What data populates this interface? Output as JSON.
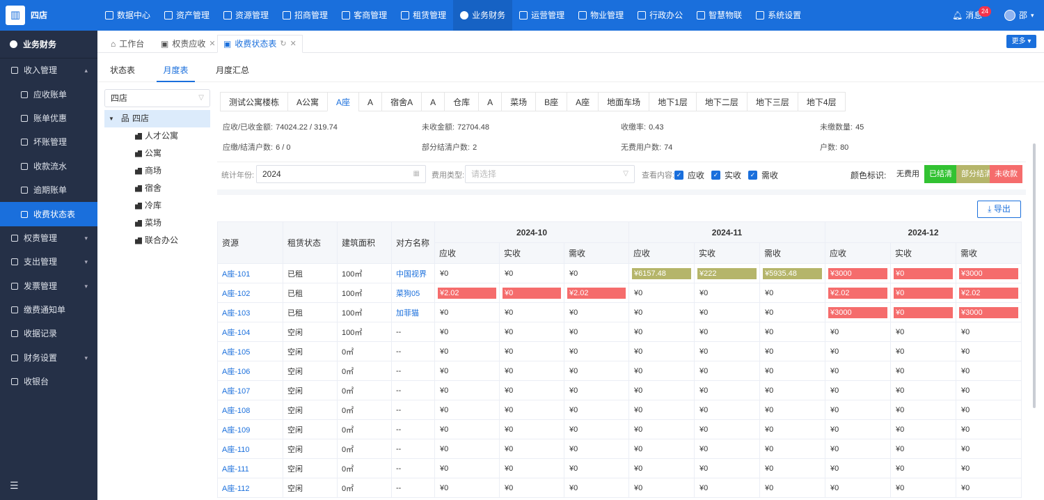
{
  "shop_name": "四店",
  "topnav": [
    "数据中心",
    "资产管理",
    "资源管理",
    "招商管理",
    "客商管理",
    "租赁管理",
    "业务财务",
    "运营管理",
    "物业管理",
    "行政办公",
    "智慧物联",
    "系统设置"
  ],
  "topnav_active": "业务财务",
  "message": {
    "label": "消息",
    "count": "24"
  },
  "user": {
    "name": "邵"
  },
  "sidebar": {
    "title": "业务财务",
    "items": [
      {
        "label": "收入管理",
        "level": 0,
        "chev": "▴"
      },
      {
        "label": "应收账单",
        "level": 1
      },
      {
        "label": "账单优惠",
        "level": 1
      },
      {
        "label": "坏账管理",
        "level": 1
      },
      {
        "label": "收款流水",
        "level": 1
      },
      {
        "label": "逾期账单",
        "level": 1
      },
      {
        "label": "收费状态表",
        "level": 1,
        "active": true
      },
      {
        "label": "权责管理",
        "level": 0,
        "chev": "▾"
      },
      {
        "label": "支出管理",
        "level": 0,
        "chev": "▾"
      },
      {
        "label": "发票管理",
        "level": 0,
        "chev": "▾"
      },
      {
        "label": "缴费通知单",
        "level": 0
      },
      {
        "label": "收据记录",
        "level": 0
      },
      {
        "label": "财务设置",
        "level": 0,
        "chev": "▾"
      },
      {
        "label": "收银台",
        "level": 0
      }
    ]
  },
  "page_tabs": [
    {
      "label": "工作台"
    },
    {
      "label": "权责应收"
    },
    {
      "label": "收费状态表",
      "active": true
    }
  ],
  "more_label": "更多 ▾",
  "subtabs": [
    "状态表",
    "月度表",
    "月度汇总"
  ],
  "tree": {
    "select": "四店",
    "root": "四店",
    "children": [
      "人才公寓",
      "公寓",
      "商场",
      "宿舍",
      "冷库",
      "菜场",
      "联合办公"
    ]
  },
  "building_tabs": [
    "测试公寓楼栋",
    "A公寓",
    "A座",
    "A",
    "宿舍A",
    "A",
    "仓库",
    "A",
    "菜场",
    "B座",
    "A座",
    "地面车场",
    "地下1层",
    "地下二层",
    "地下三层",
    "地下4层"
  ],
  "building_active": 2,
  "stats": [
    {
      "label": "应收/已收金额:",
      "value": "74024.22 / 319.74"
    },
    {
      "label": "未收金额:",
      "value": "72704.48"
    },
    {
      "label": "收缴率:",
      "value": "0.43"
    },
    {
      "label": "未缴数量:",
      "value": "45"
    },
    {
      "label": "应缴/结清户数:",
      "value": "6 / 0"
    },
    {
      "label": "部分结清户数:",
      "value": "2"
    },
    {
      "label": "无费用户数:",
      "value": "74"
    },
    {
      "label": "户数:",
      "value": "80"
    }
  ],
  "filter": {
    "year_label": "统计年份:",
    "year_value": "2024",
    "type_label": "费用类型:",
    "type_placeholder": "请选择",
    "view_label": "查看内容:",
    "checks": [
      "应收",
      "实收",
      "需收"
    ],
    "color_label": "颜色标识:",
    "legend": [
      {
        "label": "无费用",
        "color": "#ffffff"
      },
      {
        "label": "已结清",
        "color": "#32c232"
      },
      {
        "label": "部分结清",
        "color": "#b5b56a"
      },
      {
        "label": "未收款",
        "color": "#f56c6c"
      }
    ]
  },
  "export_label": "导出",
  "table": {
    "fixed_headers": [
      "资源",
      "租赁状态",
      "建筑面积",
      "对方名称"
    ],
    "months": [
      "2024-10",
      "2024-11",
      "2024-12"
    ],
    "sub_headers": [
      "应收",
      "实收",
      "需收"
    ],
    "rows": [
      {
        "res": "A座-101",
        "status": "已租",
        "area": "100㎡",
        "party": "中国视界",
        "cells": [
          [
            "¥0",
            ""
          ],
          [
            "¥0",
            ""
          ],
          [
            "¥0",
            ""
          ],
          [
            "¥6157.48",
            "p"
          ],
          [
            "¥222",
            "p"
          ],
          [
            "¥5935.48",
            "p"
          ],
          [
            "¥3000",
            "u"
          ],
          [
            "¥0",
            "u"
          ],
          [
            "¥3000",
            "u"
          ]
        ]
      },
      {
        "res": "A座-102",
        "status": "已租",
        "area": "100㎡",
        "party": "菜狗05",
        "cells": [
          [
            "¥2.02",
            "u"
          ],
          [
            "¥0",
            "u"
          ],
          [
            "¥2.02",
            "u"
          ],
          [
            "¥0",
            ""
          ],
          [
            "¥0",
            ""
          ],
          [
            "¥0",
            ""
          ],
          [
            "¥2.02",
            "u"
          ],
          [
            "¥0",
            "u"
          ],
          [
            "¥2.02",
            "u"
          ]
        ]
      },
      {
        "res": "A座-103",
        "status": "已租",
        "area": "100㎡",
        "party": "加菲猫",
        "cells": [
          [
            "¥0",
            ""
          ],
          [
            "¥0",
            ""
          ],
          [
            "¥0",
            ""
          ],
          [
            "¥0",
            ""
          ],
          [
            "¥0",
            ""
          ],
          [
            "¥0",
            ""
          ],
          [
            "¥3000",
            "u"
          ],
          [
            "¥0",
            "u"
          ],
          [
            "¥3000",
            "u"
          ]
        ]
      },
      {
        "res": "A座-104",
        "status": "空闲",
        "area": "100㎡",
        "party": "--",
        "cells": [
          [
            "¥0",
            ""
          ],
          [
            "¥0",
            ""
          ],
          [
            "¥0",
            ""
          ],
          [
            "¥0",
            ""
          ],
          [
            "¥0",
            ""
          ],
          [
            "¥0",
            ""
          ],
          [
            "¥0",
            ""
          ],
          [
            "¥0",
            ""
          ],
          [
            "¥0",
            ""
          ]
        ]
      },
      {
        "res": "A座-105",
        "status": "空闲",
        "area": "0㎡",
        "party": "--",
        "cells": [
          [
            "¥0",
            ""
          ],
          [
            "¥0",
            ""
          ],
          [
            "¥0",
            ""
          ],
          [
            "¥0",
            ""
          ],
          [
            "¥0",
            ""
          ],
          [
            "¥0",
            ""
          ],
          [
            "¥0",
            ""
          ],
          [
            "¥0",
            ""
          ],
          [
            "¥0",
            ""
          ]
        ]
      },
      {
        "res": "A座-106",
        "status": "空闲",
        "area": "0㎡",
        "party": "--",
        "cells": [
          [
            "¥0",
            ""
          ],
          [
            "¥0",
            ""
          ],
          [
            "¥0",
            ""
          ],
          [
            "¥0",
            ""
          ],
          [
            "¥0",
            ""
          ],
          [
            "¥0",
            ""
          ],
          [
            "¥0",
            ""
          ],
          [
            "¥0",
            ""
          ],
          [
            "¥0",
            ""
          ]
        ]
      },
      {
        "res": "A座-107",
        "status": "空闲",
        "area": "0㎡",
        "party": "--",
        "cells": [
          [
            "¥0",
            ""
          ],
          [
            "¥0",
            ""
          ],
          [
            "¥0",
            ""
          ],
          [
            "¥0",
            ""
          ],
          [
            "¥0",
            ""
          ],
          [
            "¥0",
            ""
          ],
          [
            "¥0",
            ""
          ],
          [
            "¥0",
            ""
          ],
          [
            "¥0",
            ""
          ]
        ]
      },
      {
        "res": "A座-108",
        "status": "空闲",
        "area": "0㎡",
        "party": "--",
        "cells": [
          [
            "¥0",
            ""
          ],
          [
            "¥0",
            ""
          ],
          [
            "¥0",
            ""
          ],
          [
            "¥0",
            ""
          ],
          [
            "¥0",
            ""
          ],
          [
            "¥0",
            ""
          ],
          [
            "¥0",
            ""
          ],
          [
            "¥0",
            ""
          ],
          [
            "¥0",
            ""
          ]
        ]
      },
      {
        "res": "A座-109",
        "status": "空闲",
        "area": "0㎡",
        "party": "--",
        "cells": [
          [
            "¥0",
            ""
          ],
          [
            "¥0",
            ""
          ],
          [
            "¥0",
            ""
          ],
          [
            "¥0",
            ""
          ],
          [
            "¥0",
            ""
          ],
          [
            "¥0",
            ""
          ],
          [
            "¥0",
            ""
          ],
          [
            "¥0",
            ""
          ],
          [
            "¥0",
            ""
          ]
        ]
      },
      {
        "res": "A座-110",
        "status": "空闲",
        "area": "0㎡",
        "party": "--",
        "cells": [
          [
            "¥0",
            ""
          ],
          [
            "¥0",
            ""
          ],
          [
            "¥0",
            ""
          ],
          [
            "¥0",
            ""
          ],
          [
            "¥0",
            ""
          ],
          [
            "¥0",
            ""
          ],
          [
            "¥0",
            ""
          ],
          [
            "¥0",
            ""
          ],
          [
            "¥0",
            ""
          ]
        ]
      },
      {
        "res": "A座-111",
        "status": "空闲",
        "area": "0㎡",
        "party": "--",
        "cells": [
          [
            "¥0",
            ""
          ],
          [
            "¥0",
            ""
          ],
          [
            "¥0",
            ""
          ],
          [
            "¥0",
            ""
          ],
          [
            "¥0",
            ""
          ],
          [
            "¥0",
            ""
          ],
          [
            "¥0",
            ""
          ],
          [
            "¥0",
            ""
          ],
          [
            "¥0",
            ""
          ]
        ]
      },
      {
        "res": "A座-112",
        "status": "空闲",
        "area": "0㎡",
        "party": "--",
        "cells": [
          [
            "¥0",
            ""
          ],
          [
            "¥0",
            ""
          ],
          [
            "¥0",
            ""
          ],
          [
            "¥0",
            ""
          ],
          [
            "¥0",
            ""
          ],
          [
            "¥0",
            ""
          ],
          [
            "¥0",
            ""
          ],
          [
            "¥0",
            ""
          ],
          [
            "¥0",
            ""
          ]
        ]
      }
    ]
  },
  "colors": {
    "paid": "#32c232",
    "partial": "#b5b56a",
    "unpaid": "#f56c6c",
    "primary": "#1a6fdc"
  }
}
